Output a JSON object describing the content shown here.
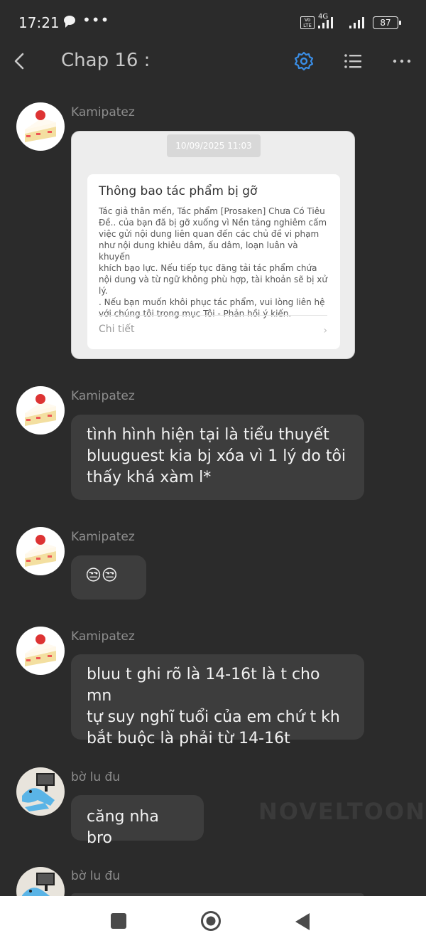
{
  "status_bar": {
    "time": "17:21",
    "dots": "•••",
    "volte": "Vo LTE",
    "network": "4G",
    "battery": "87"
  },
  "header": {
    "title": "Chap 16 :"
  },
  "messages": [
    {
      "username": "Kamipatez",
      "avatar": "cake-avatar",
      "notice": {
        "date": "10/09/2025 11:03",
        "title": "Thông bao tác phẩm bị gỡ",
        "body_lines": [
          "Tác giả thân mến, Tác phẩm [Prosaken] Chưa Có Tiêu",
          "Đề.. của bạn đã bị gỡ xuống vì Nền tảng nghiêm cấm",
          "việc gửi nội dung liên quan đến các chủ đề vi phạm",
          "như nội dung khiêu dâm, ấu dâm, loạn luân và khuyến",
          "khích bạo lực. Nếu tiếp tục đăng tải tác phẩm chứa",
          "nội dung và từ ngữ không phù hợp, tài khoản sẽ bị xử",
          "lý.",
          ". Nếu bạn muốn khôi phục tác phẩm, vui lòng liên hệ",
          "với chúng tôi trong mục Tôi - Phản hồi ý kiến."
        ],
        "details_label": "Chi tiết"
      }
    },
    {
      "username": "Kamipatez",
      "avatar": "cake-avatar",
      "lines": [
        "tình hình hiện tại là tiểu thuyết",
        "bluuguest kia bj xóa vì 1 lý do tôi",
        "thấy khá xàm l*"
      ]
    },
    {
      "username": "Kamipatez",
      "avatar": "cake-avatar",
      "emoji": "😒😒"
    },
    {
      "username": "Kamipatez",
      "avatar": "cake-avatar",
      "lines": [
        "bluu t ghi rõ là 14-16t là t cho mn",
        "tự suy nghĩ tuổi của em chứ t kh",
        "bắt buộc là phải từ 14-16t"
      ]
    },
    {
      "username": "bờ lu đu",
      "avatar": "blue-character-avatar",
      "lines": [
        "căng nha bro"
      ]
    },
    {
      "username": "bờ lu đu",
      "avatar": "blue-character-avatar"
    }
  ],
  "watermark": "NOVELTOON",
  "colors": {
    "accent": "#3a8ee6",
    "background": "#2b2b2b",
    "bubble": "#3d3d3d"
  }
}
